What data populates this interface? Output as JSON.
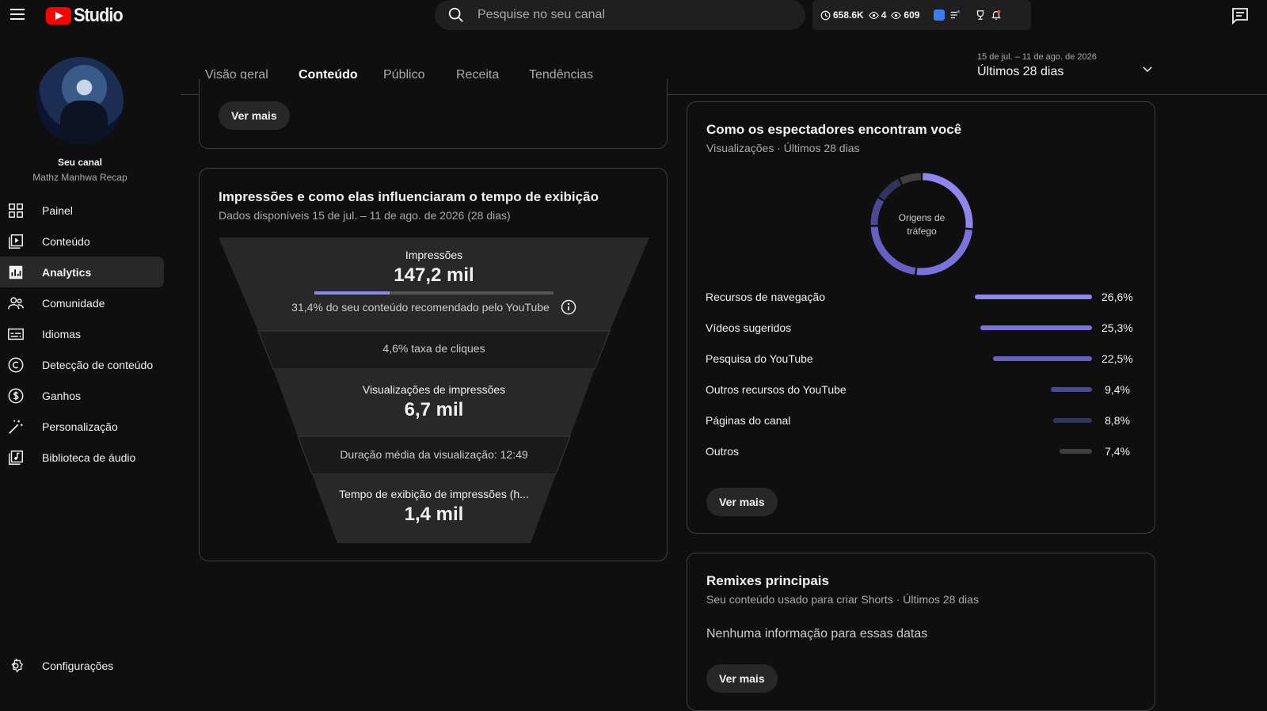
{
  "header": {
    "app_name": "Studio",
    "search_placeholder": "Pesquise no seu canal",
    "stats": {
      "watch_hours": "658.6K",
      "live_viewers": "4",
      "views": "609"
    }
  },
  "sidebar": {
    "channel_label": "Seu canal",
    "channel_name": "Mathz Manhwa Recap",
    "items": [
      {
        "label": "Painel",
        "icon": "dashboard-icon"
      },
      {
        "label": "Conteúdo",
        "icon": "content-icon"
      },
      {
        "label": "Analytics",
        "icon": "analytics-icon",
        "active": true
      },
      {
        "label": "Comunidade",
        "icon": "community-icon"
      },
      {
        "label": "Idiomas",
        "icon": "subtitles-icon"
      },
      {
        "label": "Detecção de conteúdo",
        "icon": "copyright-icon"
      },
      {
        "label": "Ganhos",
        "icon": "dollar-icon"
      },
      {
        "label": "Personalização",
        "icon": "magic-wand-icon"
      },
      {
        "label": "Biblioteca de áudio",
        "icon": "audio-library-icon"
      }
    ],
    "settings_label": "Configurações"
  },
  "tabs": [
    {
      "label": "Visão geral"
    },
    {
      "label": "Conteúdo",
      "active": true
    },
    {
      "label": "Público"
    },
    {
      "label": "Receita"
    },
    {
      "label": "Tendências"
    }
  ],
  "date_range": {
    "dates": "15 de jul. – 11 de ago. de 2026",
    "label": "Últimos 28 dias"
  },
  "top_card": {
    "button": "Ver mais"
  },
  "impressions_card": {
    "title": "Impressões e como elas influenciaram o tempo de exibição",
    "subtitle": "Dados disponíveis 15 de jul. – 11 de ago. de 2026 (28 dias)",
    "impressions_label": "Impressões",
    "impressions_value": "147,2 mil",
    "recommended_fraction": 0.314,
    "recommended_note": "31,4% do seu conteúdo recomendado pelo YouTube",
    "ctr_note": "4,6% taxa de cliques",
    "impression_views_label": "Visualizações de impressões",
    "impression_views_value": "6,7 mil",
    "avg_duration_note": "Duração média da visualização: 12:49",
    "watch_time_label": "Tempo de exibição de impressões (h...",
    "watch_time_value": "1,4 mil"
  },
  "traffic_card": {
    "title": "Como os espectadores encontram você",
    "subtitle": "Visualizações · Últimos 28 dias",
    "donut_label_line1": "Origens de",
    "donut_label_line2": "tráfego",
    "button": "Ver mais",
    "sources": [
      {
        "label": "Recursos de navegação",
        "value": "26,6%",
        "pct": 26.6,
        "color": "#8f86f0"
      },
      {
        "label": "Vídeos sugeridos",
        "value": "25,3%",
        "pct": 25.3,
        "color": "#7b73dd"
      },
      {
        "label": "Pesquisa do YouTube",
        "value": "22,5%",
        "pct": 22.5,
        "color": "#6760c2"
      },
      {
        "label": "Outros recursos do YouTube",
        "value": "9,4%",
        "pct": 9.4,
        "color": "#4c4896"
      },
      {
        "label": "Páginas do canal",
        "value": "8,8%",
        "pct": 8.8,
        "color": "#33335e"
      },
      {
        "label": "Outros",
        "value": "7,4%",
        "pct": 7.4,
        "color": "#3f3f3f"
      }
    ]
  },
  "remix_card": {
    "title": "Remixes principais",
    "subtitle": "Seu conteúdo usado para criar Shorts · Últimos 28 dias",
    "empty": "Nenhuma informação para essas datas",
    "button": "Ver mais"
  }
}
